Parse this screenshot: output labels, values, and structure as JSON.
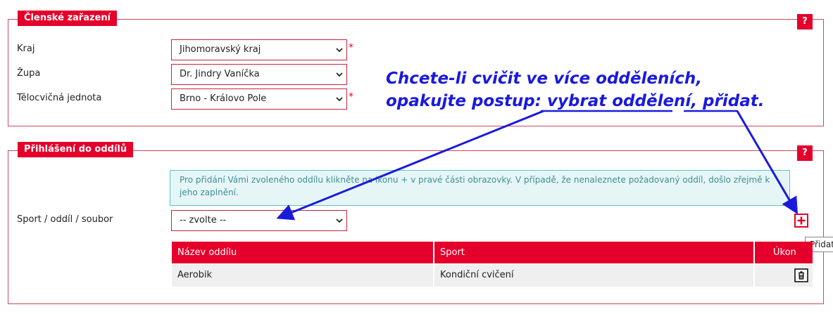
{
  "membership": {
    "legend": "Členské zařazení",
    "help_label": "?",
    "fields": [
      {
        "label": "Kraj",
        "value": "Jihomoravský kraj",
        "required": "*"
      },
      {
        "label": "Župa",
        "value": "Dr. Jindry Vaníčka"
      },
      {
        "label": "Tělocvičná jednota",
        "value": "Brno - Královo Pole",
        "required": "*"
      }
    ]
  },
  "annotation": {
    "line1": "Chcete-li cvičit ve více odděleních,",
    "line2": "opakujte postup: vybrat oddělení, přidat."
  },
  "signup": {
    "legend": "Přihlášení do oddílů",
    "help_label": "?",
    "info_text": "Pro přidání Vámi zvoleného oddílu klikněte na ikonu + v pravé části obrazovky. V případě, že nenaleznete požadovaný oddíl, došlo zřejmě k jeho zaplnění.",
    "sport_label": "Sport / oddíl / soubor",
    "sport_value": "-- zvolte --",
    "add_tooltip": "Přidat",
    "table": {
      "headers": [
        "Název oddílu",
        "Sport",
        "Úkon"
      ],
      "rows": [
        {
          "name": "Aerobik",
          "sport": "Kondiční cvičení"
        }
      ]
    }
  },
  "colors": {
    "accent": "#e4002b",
    "annotation": "#1a1adb",
    "info_bg": "#e6f6f7"
  }
}
